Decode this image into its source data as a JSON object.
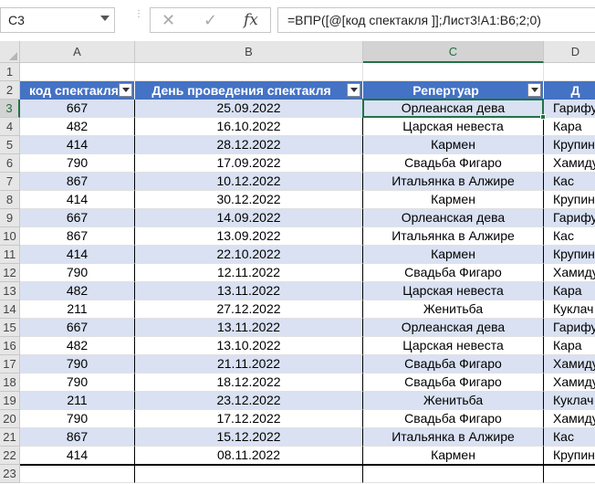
{
  "name_box": "C3",
  "formula": "=ВПР([@[код спектакля ]];Лист3!A1:B6;2;0)",
  "formula_bar": {
    "cancel_icon": "✕",
    "enter_icon": "✓",
    "fx_label": "fx"
  },
  "columns": [
    "A",
    "B",
    "C",
    "D"
  ],
  "selected_column": "C",
  "selected_row": 3,
  "header_row": [
    "код спектакля",
    "День проведения спектакля",
    "Репертуар",
    "Д"
  ],
  "rows": [
    [
      "667",
      "25.09.2022",
      "Орлеанская дева",
      "Гарифу"
    ],
    [
      "482",
      "16.10.2022",
      "Царская невеста",
      "Кара"
    ],
    [
      "414",
      "28.12.2022",
      "Кармен",
      "Крупин"
    ],
    [
      "790",
      "17.09.2022",
      "Свадьба Фигаро",
      "Хамиду"
    ],
    [
      "867",
      "10.12.2022",
      "Итальянка в Алжире",
      "Кас"
    ],
    [
      "414",
      "30.12.2022",
      "Кармен",
      "Крупин"
    ],
    [
      "667",
      "14.09.2022",
      "Орлеанская дева",
      "Гарифу"
    ],
    [
      "867",
      "13.09.2022",
      "Итальянка в Алжире",
      "Кас"
    ],
    [
      "414",
      "22.10.2022",
      "Кармен",
      "Крупин"
    ],
    [
      "790",
      "12.11.2022",
      "Свадьба Фигаро",
      "Хамиду"
    ],
    [
      "482",
      "13.11.2022",
      "Царская невеста",
      "Кара"
    ],
    [
      "211",
      "27.12.2022",
      "Женитьба",
      "Куклач"
    ],
    [
      "667",
      "13.11.2022",
      "Орлеанская дева",
      "Гарифу"
    ],
    [
      "482",
      "13.10.2022",
      "Царская невеста",
      "Кара"
    ],
    [
      "790",
      "21.11.2022",
      "Свадьба Фигаро",
      "Хамиду"
    ],
    [
      "790",
      "18.12.2022",
      "Свадьба Фигаро",
      "Хамиду"
    ],
    [
      "211",
      "23.12.2022",
      "Женитьба",
      "Куклач"
    ],
    [
      "790",
      "17.12.2022",
      "Свадьба Фигаро",
      "Хамиду"
    ],
    [
      "867",
      "15.12.2022",
      "Итальянка в Алжире",
      "Кас"
    ],
    [
      "414",
      "08.11.2022",
      "Кармен",
      "Крупин"
    ]
  ],
  "row_numbers": [
    "1",
    "2",
    "3",
    "4",
    "5",
    "6",
    "7",
    "8",
    "9",
    "10",
    "11",
    "12",
    "13",
    "14",
    "15",
    "16",
    "17",
    "18",
    "19",
    "20",
    "21",
    "22",
    "23"
  ]
}
